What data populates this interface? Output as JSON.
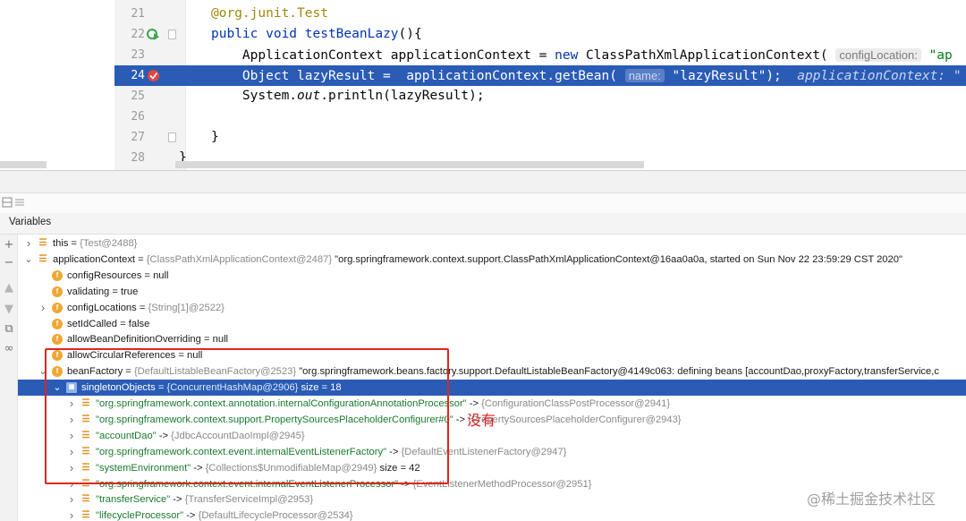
{
  "editor": {
    "lines": [
      {
        "num": "21",
        "parts": [
          {
            "t": "@org.junit.Test",
            "c": "ann"
          }
        ]
      },
      {
        "num": "22",
        "parts": [
          {
            "t": "public ",
            "c": "kw"
          },
          {
            "t": "void ",
            "c": "kw"
          },
          {
            "t": "testBeanLazy",
            "c": "kw"
          },
          {
            "t": "(){",
            "c": ""
          }
        ]
      },
      {
        "num": "23",
        "parts": [
          {
            "t": "    ApplicationContext applicationContext = ",
            "c": ""
          },
          {
            "t": "new ",
            "c": "kw"
          },
          {
            "t": "ClassPathXmlApplicationContext( ",
            "c": ""
          },
          {
            "t": "configLocation:",
            "c": "hint"
          },
          {
            "t": " \"ap",
            "c": "str"
          }
        ]
      },
      {
        "num": "24",
        "parts": [
          {
            "t": "    Object lazyResult =  applicationContext.getBean( ",
            "c": ""
          },
          {
            "t": "name:",
            "c": "hint"
          },
          {
            "t": " \"lazyResult\");  ",
            "c": ""
          },
          {
            "t": "applicationContext: \"",
            "c": "inline-debug"
          }
        ]
      },
      {
        "num": "25",
        "parts": [
          {
            "t": "    System.",
            "c": ""
          },
          {
            "t": "out",
            "c": "italic"
          },
          {
            "t": ".println(lazyResult);",
            "c": ""
          }
        ]
      },
      {
        "num": "26",
        "parts": []
      },
      {
        "num": "27",
        "parts": [
          {
            "t": "}",
            "c": ""
          }
        ]
      },
      {
        "num": "28",
        "parts": [
          {
            "t": "}",
            "c": ""
          }
        ]
      }
    ],
    "highlight_line": "24"
  },
  "variables_panel": {
    "title": "Variables",
    "rows": [
      {
        "indent": 0,
        "arrow": "›",
        "icon": "lines",
        "name": "this",
        "eq": " = ",
        "type": "{Test@2488}",
        "value": ""
      },
      {
        "indent": 0,
        "arrow": "⌄",
        "icon": "lines",
        "name": "applicationContext",
        "eq": " = ",
        "type": "{ClassPathXmlApplicationContext@2487}",
        "value": " \"org.springframework.context.support.ClassPathXmlApplicationContext@16aa0a0a, started on Sun Nov 22 23:59:29 CST 2020\""
      },
      {
        "indent": 1,
        "arrow": "",
        "icon": "f",
        "name": "configResources",
        "eq": " = ",
        "type": "",
        "value": "null"
      },
      {
        "indent": 1,
        "arrow": "",
        "icon": "f",
        "name": "validating",
        "eq": " = ",
        "type": "",
        "value": "true"
      },
      {
        "indent": 1,
        "arrow": "›",
        "icon": "f",
        "name": "configLocations",
        "eq": " = ",
        "type": "{String[1]@2522}",
        "value": ""
      },
      {
        "indent": 1,
        "arrow": "",
        "icon": "f",
        "name": "setIdCalled",
        "eq": " = ",
        "type": "",
        "value": "false"
      },
      {
        "indent": 1,
        "arrow": "",
        "icon": "f",
        "name": "allowBeanDefinitionOverriding",
        "eq": " = ",
        "type": "",
        "value": "null"
      },
      {
        "indent": 1,
        "arrow": "",
        "icon": "f",
        "name": "allowCircularReferences",
        "eq": " = ",
        "type": "",
        "value": "null"
      },
      {
        "indent": 1,
        "arrow": "⌄",
        "icon": "f",
        "name": "beanFactory",
        "eq": " = ",
        "type": "{DefaultListableBeanFactory@2523}",
        "value": " \"org.springframework.beans.factory.support.DefaultListableBeanFactory@4149c063: defining beans [accountDao,proxyFactory,transferService,c"
      },
      {
        "indent": 2,
        "arrow": "⌄",
        "icon": "map",
        "name": "singletonObjects",
        "eq": " = ",
        "type": "{ConcurrentHashMap@2906}",
        "value": "  size = 18",
        "selected": true
      },
      {
        "indent": 3,
        "arrow": "›",
        "icon": "lines",
        "name": "\"org.springframework.context.annotation.internalConfigurationAnnotationProcessor\"",
        "eq": " -> ",
        "type": "{ConfigurationClassPostProcessor@2941}",
        "value": "",
        "isStr": true
      },
      {
        "indent": 3,
        "arrow": "›",
        "icon": "lines",
        "name": "\"org.springframework.context.support.PropertySourcesPlaceholderConfigurer#0\"",
        "eq": " -> ",
        "type": "{PropertySourcesPlaceholderConfigurer@2943}",
        "value": "",
        "isStr": true
      },
      {
        "indent": 3,
        "arrow": "›",
        "icon": "lines",
        "name": "\"accountDao\"",
        "eq": " -> ",
        "type": "{JdbcAccountDaoImpl@2945}",
        "value": "",
        "isStr": true
      },
      {
        "indent": 3,
        "arrow": "›",
        "icon": "lines",
        "name": "\"org.springframework.context.event.internalEventListenerFactory\"",
        "eq": " -> ",
        "type": "{DefaultEventListenerFactory@2947}",
        "value": "",
        "isStr": true
      },
      {
        "indent": 3,
        "arrow": "›",
        "icon": "lines",
        "name": "\"systemEnvironment\"",
        "eq": " -> ",
        "type": "{Collections$UnmodifiableMap@2949}",
        "value": "  size = 42",
        "isStr": true
      },
      {
        "indent": 3,
        "arrow": "›",
        "icon": "lines",
        "name": "\"org.springframework.context.event.internalEventListenerProcessor\"",
        "eq": " -> ",
        "type": "{EventListenerMethodProcessor@2951}",
        "value": "",
        "isStr": true
      },
      {
        "indent": 3,
        "arrow": "›",
        "icon": "lines",
        "name": "\"transferService\"",
        "eq": " -> ",
        "type": "{TransferServiceImpl@2953}",
        "value": "",
        "isStr": true
      },
      {
        "indent": 3,
        "arrow": "›",
        "icon": "lines",
        "name": "\"lifecycleProcessor\"",
        "eq": " -> ",
        "type": "{DefaultLifecycleProcessor@2534}",
        "value": "",
        "isStr": true
      }
    ]
  },
  "annotation": {
    "label": "没有",
    "color": "#e02424"
  },
  "watermark": {
    "text": "@稀土掘金技术社区",
    "small": "@稀土掘金技术社区"
  },
  "colors": {
    "selection": "#2a5cb6",
    "keyword": "#0033b3",
    "string": "#067d17",
    "annotation_kw": "#9e880d"
  }
}
